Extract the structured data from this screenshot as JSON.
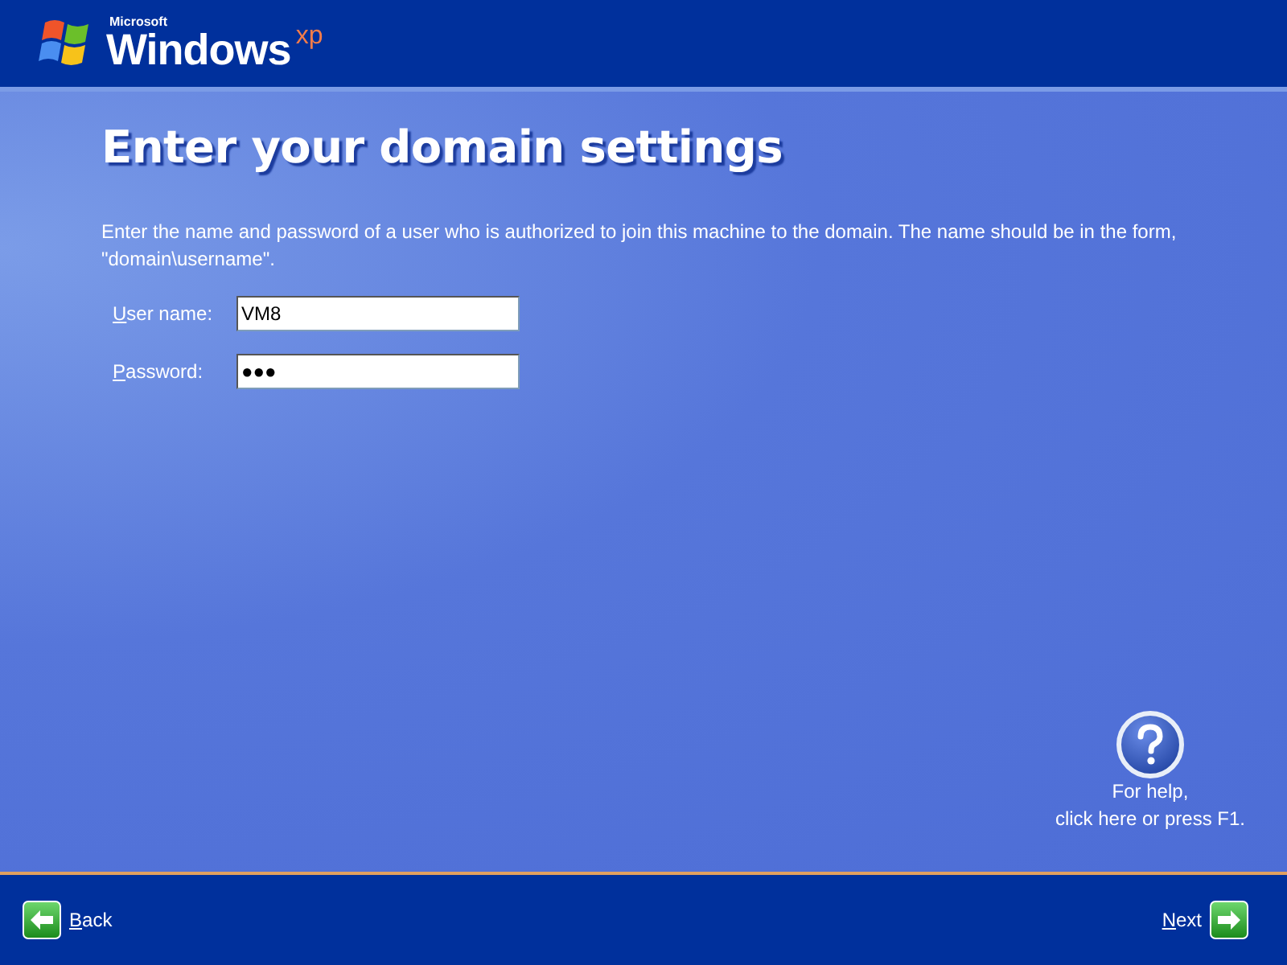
{
  "logo": {
    "maker": "Microsoft",
    "product": "Windows",
    "edition": "xp"
  },
  "title": "Enter your domain settings",
  "description": "Enter the name and password of a user who is authorized to join this machine to the domain. The name should be in the form, \"domain\\username\".",
  "fields": [
    {
      "label": "User name:",
      "value": "VM8"
    },
    {
      "label": "Password:",
      "value": "●●●"
    }
  ],
  "help": {
    "line_1": "For help,",
    "line_2": "click here or press F1."
  },
  "buttons": {
    "back": "Back",
    "next": "Next"
  }
}
